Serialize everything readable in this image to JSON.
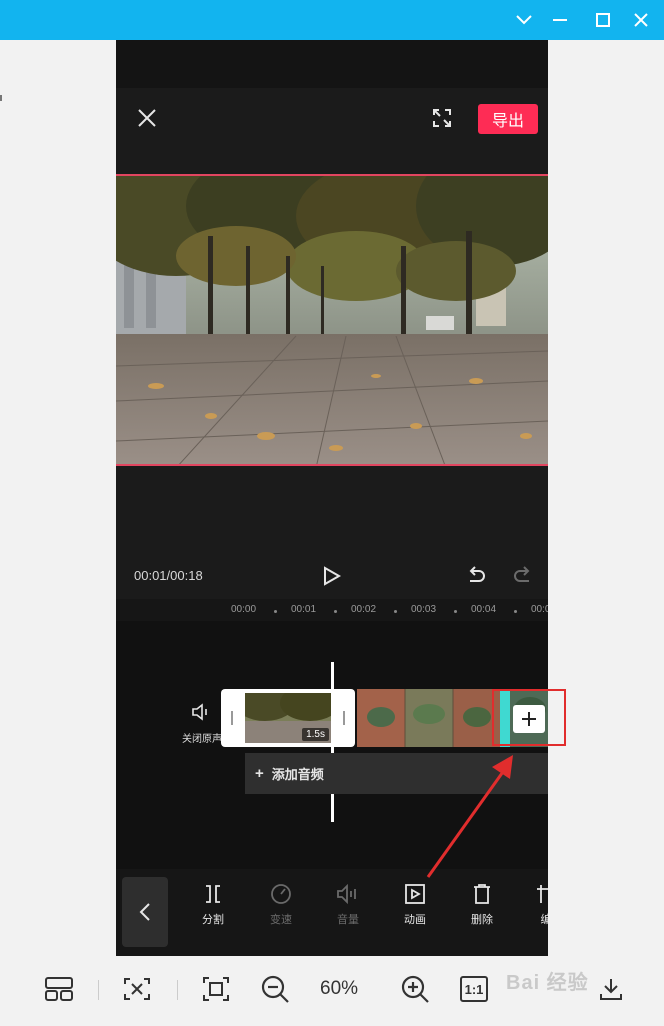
{
  "player": {
    "export_label": "导出",
    "time_display": "00:01/00:18"
  },
  "timeline": {
    "ticks": [
      "00:00",
      "00:01",
      "00:02",
      "00:03",
      "00:04",
      "00:0"
    ],
    "mute_label": "关闭原声",
    "clip_duration": "1.5s",
    "add_audio_label": "添加音频"
  },
  "bottom_tools": [
    {
      "label": "分割",
      "icon": "split-icon",
      "enabled": true
    },
    {
      "label": "变速",
      "icon": "speed-icon",
      "enabled": false
    },
    {
      "label": "音量",
      "icon": "volume-icon",
      "enabled": false
    },
    {
      "label": "动画",
      "icon": "animation-icon",
      "enabled": true
    },
    {
      "label": "删除",
      "icon": "trash-icon",
      "enabled": true
    },
    {
      "label": "编",
      "icon": "edit-icon",
      "enabled": true
    }
  ],
  "viewer_toolbar": {
    "zoom_level": "60%",
    "one_to_one_label": "1:1"
  },
  "watermark": "Bai 经验",
  "colors": {
    "titlebar": "#12b4ef",
    "export_button": "#fe2c55",
    "selection_border": "#e24560",
    "annotation_red": "#e12d2d",
    "clip_accent": "#3fd9d1"
  }
}
